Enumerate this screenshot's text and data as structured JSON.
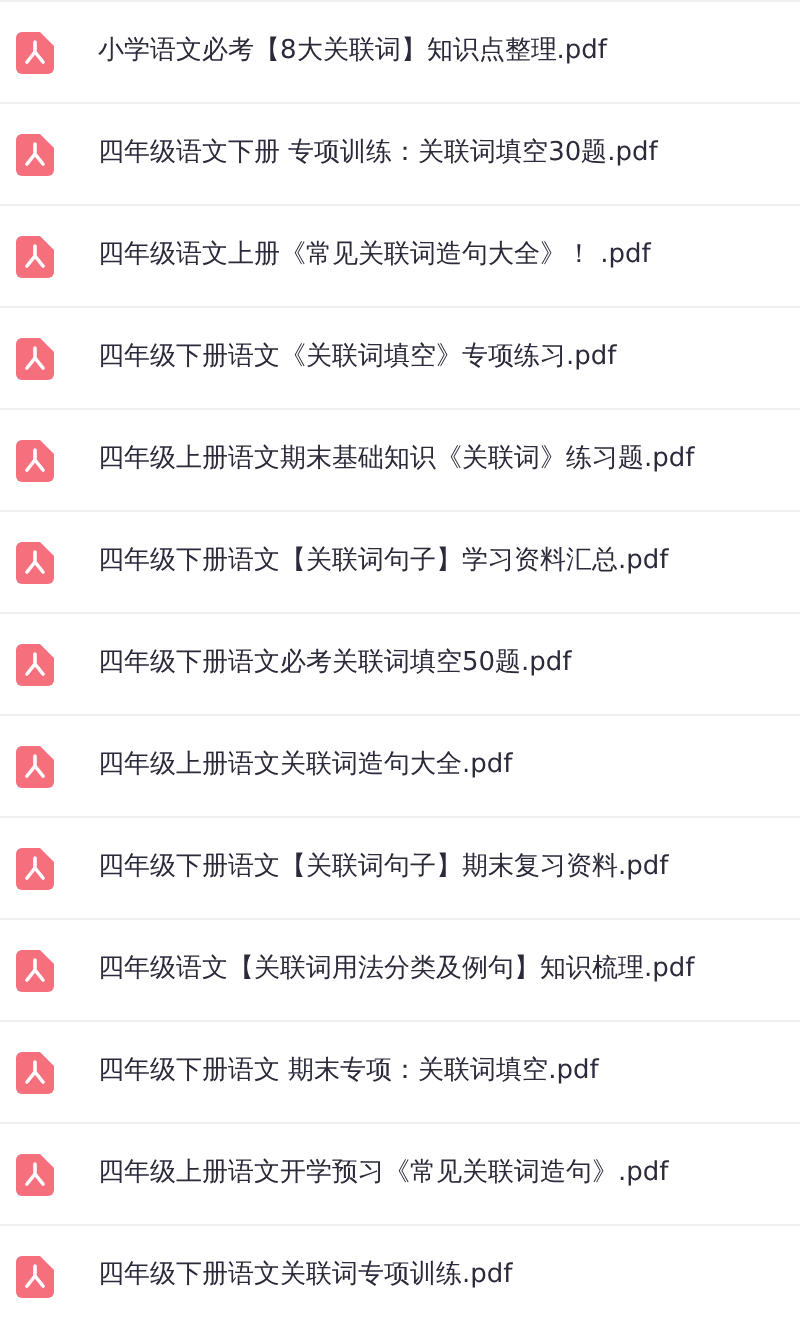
{
  "files": [
    {
      "name": "小学语文必考【8大关联词】知识点整理.pdf"
    },
    {
      "name": "四年级语文下册 专项训练：关联词填空30题.pdf"
    },
    {
      "name": "四年级语文上册《常见关联词造句大全》！ .pdf"
    },
    {
      "name": "四年级下册语文《关联词填空》专项练习.pdf"
    },
    {
      "name": "四年级上册语文期末基础知识《关联词》练习题.pdf"
    },
    {
      "name": "四年级下册语文【关联词句子】学习资料汇总.pdf"
    },
    {
      "name": "四年级下册语文必考关联词填空50题.pdf"
    },
    {
      "name": "四年级上册语文关联词造句大全.pdf"
    },
    {
      "name": "四年级下册语文【关联词句子】期末复习资料.pdf"
    },
    {
      "name": "四年级语文【关联词用法分类及例句】知识梳理.pdf"
    },
    {
      "name": "四年级下册语文 期末专项：关联词填空.pdf"
    },
    {
      "name": "四年级上册语文开学预习《常见关联词造句》.pdf"
    },
    {
      "name": "四年级下册语文关联词专项训练.pdf"
    }
  ]
}
